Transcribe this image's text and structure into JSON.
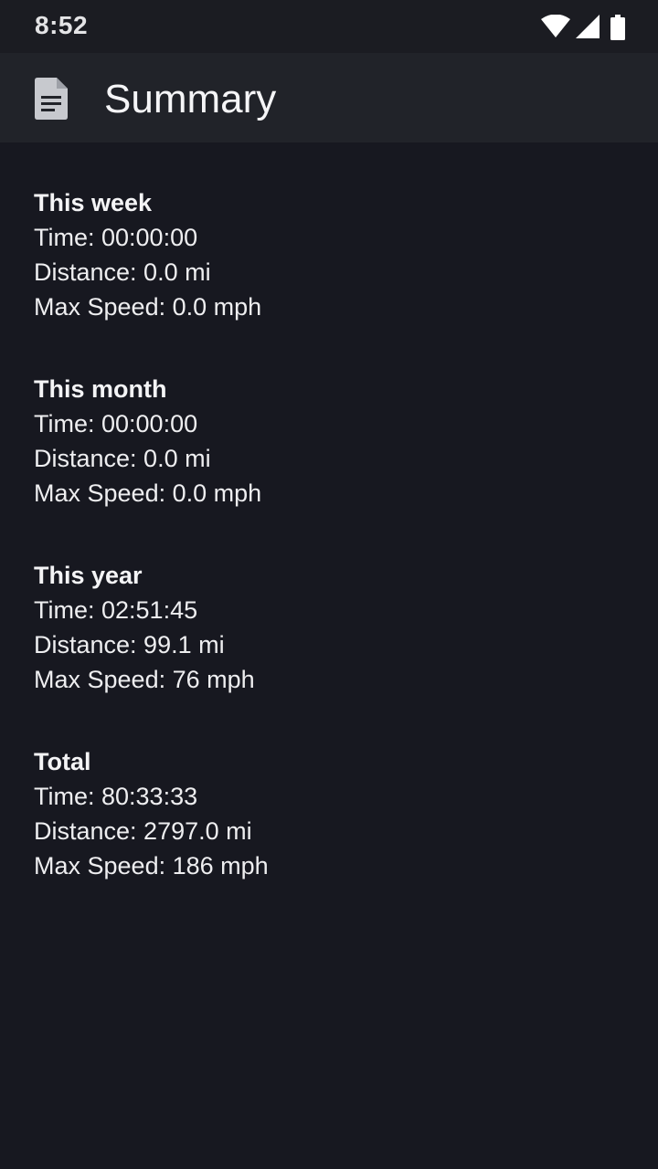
{
  "status_bar": {
    "time": "8:52",
    "icons": [
      "wifi-icon",
      "cellular-signal-icon",
      "battery-icon"
    ]
  },
  "app_bar": {
    "icon": "document-icon",
    "title": "Summary"
  },
  "sections": [
    {
      "title": "This week",
      "time": "Time: 00:00:00",
      "distance": "Distance: 0.0 mi",
      "max_speed": "Max Speed: 0.0 mph"
    },
    {
      "title": "This month",
      "time": "Time: 00:00:00",
      "distance": "Distance: 0.0 mi",
      "max_speed": "Max Speed: 0.0 mph"
    },
    {
      "title": "This year",
      "time": "Time: 02:51:45",
      "distance": "Distance: 99.1 mi",
      "max_speed": "Max Speed: 76 mph"
    },
    {
      "title": "Total",
      "time": "Time: 80:33:33",
      "distance": "Distance: 2797.0 mi",
      "max_speed": "Max Speed: 186 mph"
    }
  ],
  "colors": {
    "background": "#171820",
    "app_bar": "#212329",
    "status_bar": "#1b1c22",
    "text": "#f2f2f4"
  }
}
